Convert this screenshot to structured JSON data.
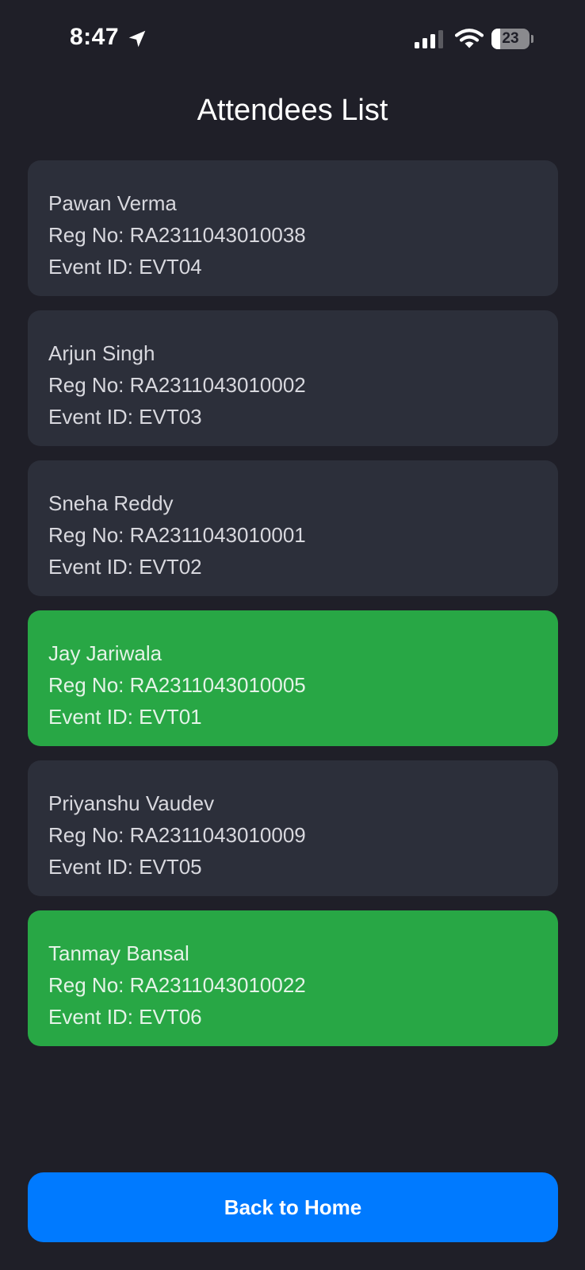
{
  "status_bar": {
    "time": "8:47",
    "battery_level": "23",
    "battery_fraction": 0.23,
    "icons": [
      "location-arrow-icon",
      "cellular-signal-icon",
      "wifi-icon",
      "battery-icon"
    ]
  },
  "page": {
    "title": "Attendees List"
  },
  "attendees": [
    {
      "name": "Pawan Verma",
      "reg_line": "Reg No: RA2311043010038",
      "event_line": "Event ID: EVT04",
      "highlighted": false
    },
    {
      "name": "Arjun Singh",
      "reg_line": "Reg No: RA2311043010002",
      "event_line": "Event ID: EVT03",
      "highlighted": false
    },
    {
      "name": "Sneha Reddy",
      "reg_line": "Reg No: RA2311043010001",
      "event_line": "Event ID: EVT02",
      "highlighted": false
    },
    {
      "name": "Jay Jariwala",
      "reg_line": "Reg No: RA2311043010005",
      "event_line": "Event ID: EVT01",
      "highlighted": true
    },
    {
      "name": "Priyanshu Vaudev",
      "reg_line": "Reg No: RA2311043010009",
      "event_line": "Event ID: EVT05",
      "highlighted": false
    },
    {
      "name": "Tanmay Bansal",
      "reg_line": "Reg No: RA2311043010022",
      "event_line": "Event ID: EVT06",
      "highlighted": true
    }
  ],
  "footer": {
    "back_label": "Back to Home"
  },
  "colors": {
    "background": "#1f1f28",
    "card": "#2c2f3a",
    "card_highlighted": "#28a745",
    "primary_button": "#007aff"
  }
}
